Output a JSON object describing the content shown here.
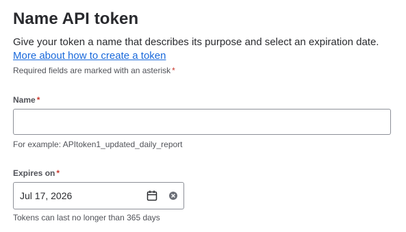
{
  "page": {
    "title": "Name API token",
    "description": "Give your token a name that describes its purpose and select an expiration date.",
    "help_link": "More about how to create a token",
    "required_note": "Required fields are marked with an asterisk",
    "asterisk": "*"
  },
  "name_field": {
    "label": "Name",
    "value": "",
    "helper": "For example: APItoken1_updated_daily_report"
  },
  "expires_field": {
    "label": "Expires on",
    "value": "Jul 17, 2026",
    "helper": "Tokens can last no longer than 365 days",
    "calendar_icon": "calendar-icon",
    "clear_icon": "clear-icon"
  },
  "colors": {
    "link": "#1868db",
    "required": "#c9372c",
    "border": "#8c8f97"
  }
}
